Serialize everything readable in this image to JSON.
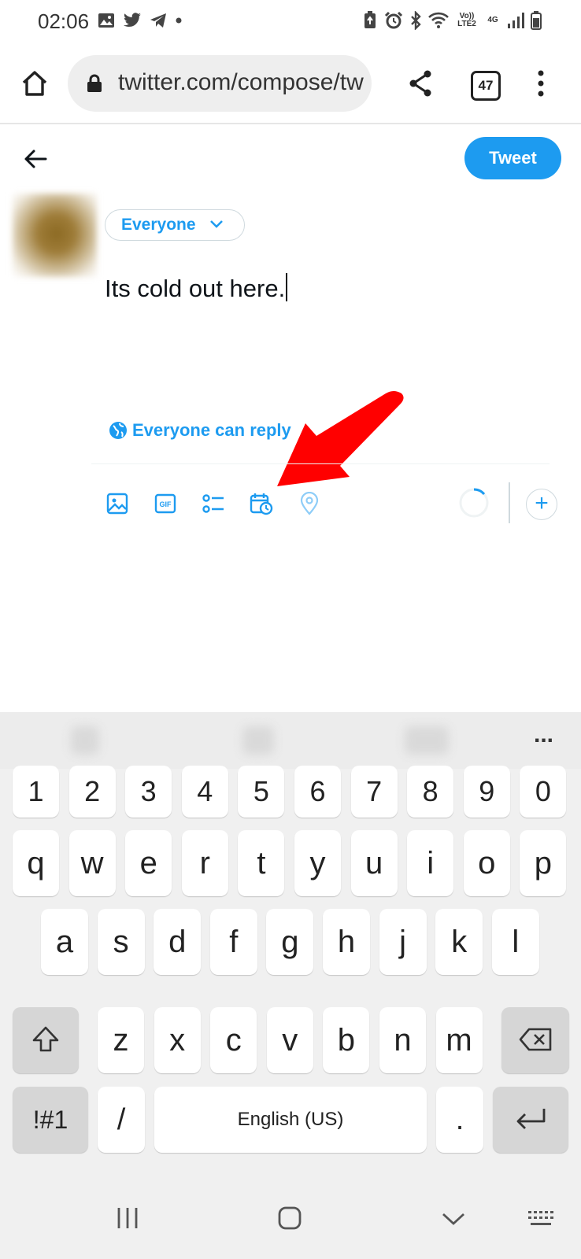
{
  "status_bar": {
    "time": "02:06",
    "volte_label": "Vo)) LTE2",
    "network_label": "4G"
  },
  "browser": {
    "url": "twitter.com/compose/tweet",
    "tab_count": "47"
  },
  "compose": {
    "tweet_button": "Tweet",
    "audience": "Everyone",
    "text": "Its cold out here.",
    "reply_setting": "Everyone can reply"
  },
  "keyboard": {
    "row_numbers": [
      "1",
      "2",
      "3",
      "4",
      "5",
      "6",
      "7",
      "8",
      "9",
      "0"
    ],
    "row_top": [
      "q",
      "w",
      "e",
      "r",
      "t",
      "y",
      "u",
      "i",
      "o",
      "p"
    ],
    "row_middle": [
      "a",
      "s",
      "d",
      "f",
      "g",
      "h",
      "j",
      "k",
      "l"
    ],
    "row_bottom": [
      "z",
      "x",
      "c",
      "v",
      "b",
      "n",
      "m"
    ],
    "symbols_key": "!#1",
    "slash_key": "/",
    "space_label": "English (US)",
    "period_key": ".",
    "more_label": "..."
  },
  "colors": {
    "accent": "#1d9bf0",
    "arrow": "#ff0000"
  }
}
